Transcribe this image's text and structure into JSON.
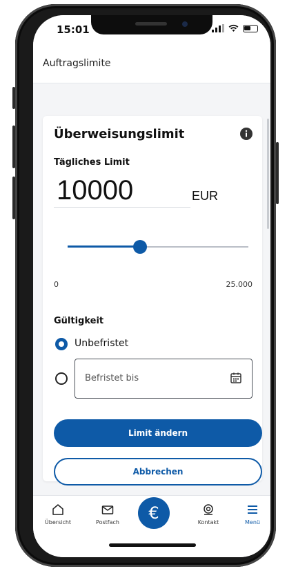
{
  "status_bar": {
    "time": "15:01"
  },
  "app_bar": {
    "title": "Auftragslimite"
  },
  "card": {
    "title": "Überweisungslimit",
    "daily_limit_label": "Tägliches Limit",
    "amount": "10000",
    "currency": "EUR",
    "slider": {
      "min_label": "0",
      "max_label": "25.000",
      "value": 10000,
      "min": 0,
      "max": 25000
    },
    "validity_label": "Gültigkeit",
    "options": {
      "unlimited_label": "Unbefristet",
      "unlimited_selected": true,
      "limited_placeholder": "Befristet bis",
      "limited_selected": false
    },
    "primary_button": "Limit ändern",
    "secondary_button": "Abbrechen"
  },
  "bottom_nav": {
    "items": [
      {
        "label": "Übersicht",
        "icon": "home-icon"
      },
      {
        "label": "Postfach",
        "icon": "mail-icon"
      },
      {
        "label": "",
        "icon": "euro-icon",
        "symbol": "€"
      },
      {
        "label": "Kontakt",
        "icon": "headset-icon"
      },
      {
        "label": "Menü",
        "icon": "menu-icon"
      }
    ]
  },
  "colors": {
    "accent": "#0e5aa7",
    "background": "#f4f5f7",
    "card": "#ffffff"
  }
}
